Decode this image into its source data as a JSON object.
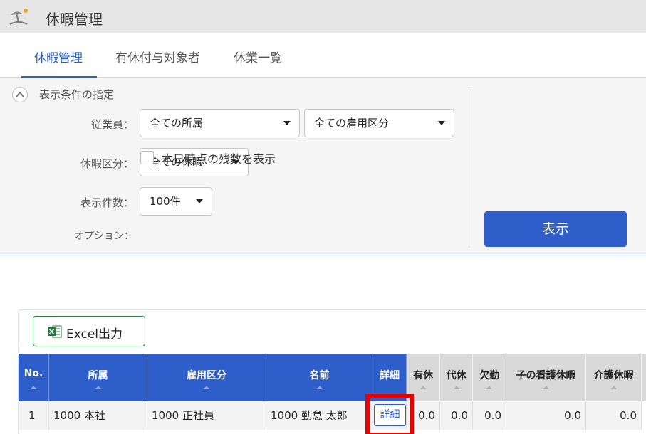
{
  "app": {
    "title": "休暇管理",
    "icon": "beach-umbrella-icon"
  },
  "tabs": [
    {
      "label": "休暇管理",
      "active": true
    },
    {
      "label": "有休付与対象者",
      "active": false
    },
    {
      "label": "休業一覧",
      "active": false
    }
  ],
  "filter": {
    "heading": "表示条件の指定",
    "employee_label": "従業員：",
    "affiliation_value": "全ての所属",
    "employment_type_value": "全ての雇用区分",
    "leave_type_label": "休暇区分：",
    "leave_type_value": "全ての休暇",
    "count_label": "表示件数：",
    "count_value": "100件",
    "option_label": "オプション：",
    "option_checkbox_label": "本日時点の残数を表示",
    "option_checked": false,
    "submit_label": "表示"
  },
  "export": {
    "label": "Excel出力"
  },
  "table": {
    "headers": [
      "No.",
      "所属",
      "雇用区分",
      "名前",
      "詳細",
      "有休",
      "代休",
      "欠勤",
      "子の看護休暇",
      "介護休暇"
    ],
    "rows": [
      {
        "no": "1",
        "affiliation": "1000 本社",
        "employment_type": "1000 正社員",
        "name": "1000 勤怠 太郎",
        "detail_button": "詳細",
        "paid_leave": "0.0",
        "comp_leave": "0.0",
        "absence": "0.0",
        "child_care_leave": "0.0",
        "nursing_care_leave": "0.0"
      }
    ]
  },
  "colors": {
    "accent": "#2d5ec9",
    "highlight": "#e60000",
    "excel_green": "#1f7a3a"
  }
}
